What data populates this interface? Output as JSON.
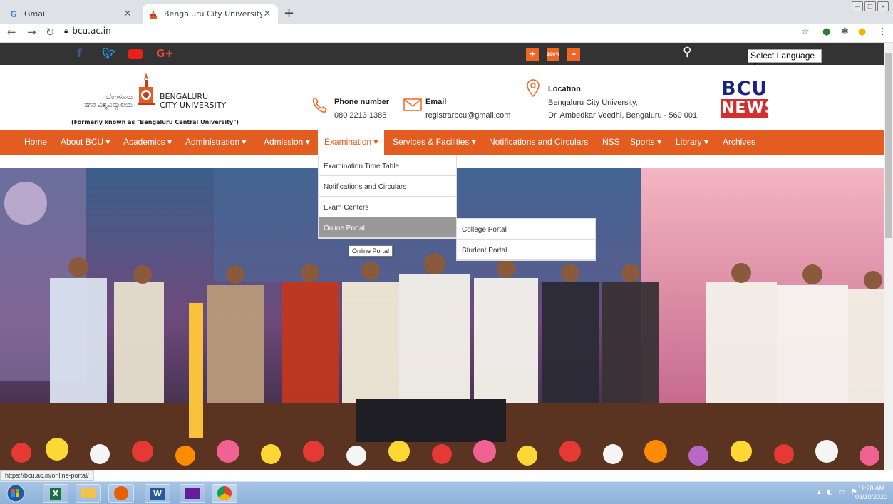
{
  "browser": {
    "tabs": [
      {
        "title": "Gmail",
        "favicon": "G"
      },
      {
        "title": "Bengaluru City University",
        "favicon": "bcu-flame"
      }
    ],
    "url": "bcu.ac.in",
    "status_url": "https://bcu.ac.in/online-portal/"
  },
  "topbar": {
    "social": [
      "f",
      "t",
      "yt",
      "G+"
    ],
    "accessibility": {
      "increase": "+",
      "reset": "100%",
      "decrease": "–"
    },
    "language_select": "Select Language ✔"
  },
  "header": {
    "logo_kannada_line1": "ಬೆಂಗಳೂರು",
    "logo_kannada_line2": "ನಗರ ವಿಶ್ವವಿದ್ಯಾಲಯ",
    "logo_name_line1": "BENGALURU",
    "logo_name_line2": "CITY UNIVERSITY",
    "formerly": "(Formerly known as \"Bengaluru Central University\")",
    "phone_label": "Phone number",
    "phone_value": "080 2213 1385",
    "email_label": "Email",
    "email_value": "registrarbcu@gmail.com",
    "location_label": "Location",
    "location_line1": "Bengaluru City University,",
    "location_line2": "Dr. Ambedkar Veedhi, Bengaluru - 560 001",
    "news_logo_top": "BCU",
    "news_logo_bottom": "NEWS"
  },
  "menu": {
    "items": [
      "Home",
      "About BCU ▾",
      "Academics ▾",
      "Administration ▾",
      "Admission ▾",
      "Examination ▾",
      "Services & Facilities ▾",
      "Notifications and Circulars",
      "NSS",
      "Sports ▾",
      "Library ▾",
      "Archives"
    ],
    "active": "Examination"
  },
  "dropdown": {
    "items": [
      "Examination Time Table",
      "Notifications and Circulars",
      "Exam Centers",
      "Online Portal"
    ],
    "submenu": [
      "College Portal",
      "Student Portal"
    ],
    "tooltip": "Online Portal"
  },
  "taskbar": {
    "time": "11:28 AM",
    "date": "03/10/2020"
  },
  "colors": {
    "brand_orange": "#e35d20",
    "topbar_dark": "#333333"
  }
}
